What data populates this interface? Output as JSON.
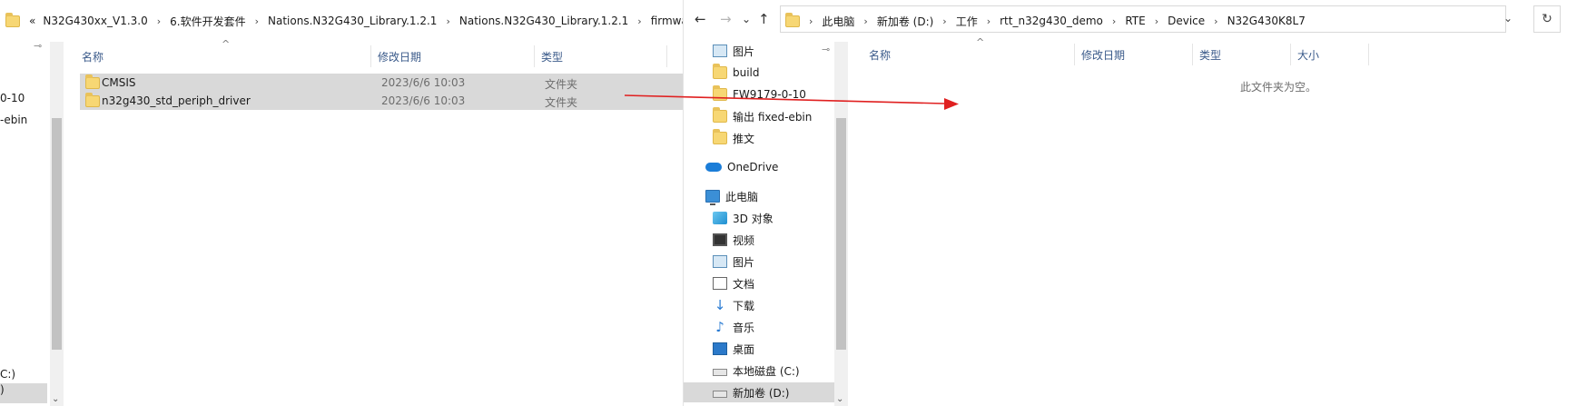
{
  "left_window": {
    "breadcrumbs": [
      "«",
      "N32G430xx_V1.3.0",
      "6.软件开发套件",
      "Nations.N32G430_Library.1.2.1",
      "Nations.N32G430_Library.1.2.1",
      "firmware"
    ],
    "columns": {
      "name": "名称",
      "date": "修改日期",
      "type": "类型"
    },
    "files": [
      {
        "name": "CMSIS",
        "date": "2023/6/6 10:03",
        "type": "文件夹"
      },
      {
        "name": "n32g430_std_periph_driver",
        "date": "2023/6/6 10:03",
        "type": "文件夹"
      }
    ],
    "nav_partial": [
      "0-10",
      "-ebin",
      "C:)",
      ")"
    ]
  },
  "right_window": {
    "nav_buttons": {
      "back": "←",
      "forward": "→",
      "down": "⌄",
      "up": "↑"
    },
    "breadcrumbs": [
      "此电脑",
      "新加卷 (D:)",
      "工作",
      "rtt_n32g430_demo",
      "RTE",
      "Device",
      "N32G430K8L7"
    ],
    "columns": {
      "name": "名称",
      "date": "修改日期",
      "type": "类型",
      "size": "大小"
    },
    "empty_message": "此文件夹为空。",
    "nav_items": [
      {
        "label": "图片",
        "icon": "pictures-icon"
      },
      {
        "label": "build",
        "icon": "folder-icon"
      },
      {
        "label": "FW9179-0-10",
        "icon": "folder-icon"
      },
      {
        "label": "输出 fixed-ebin",
        "icon": "folder-icon"
      },
      {
        "label": "推文",
        "icon": "folder-icon"
      },
      {
        "label": "OneDrive",
        "icon": "onedrive-icon"
      },
      {
        "label": "此电脑",
        "icon": "computer-icon"
      },
      {
        "label": "3D 对象",
        "icon": "3d-objects-icon"
      },
      {
        "label": "视频",
        "icon": "video-icon"
      },
      {
        "label": "图片",
        "icon": "pictures-icon"
      },
      {
        "label": "文档",
        "icon": "documents-icon"
      },
      {
        "label": "下载",
        "icon": "download-icon"
      },
      {
        "label": "音乐",
        "icon": "music-icon"
      },
      {
        "label": "桌面",
        "icon": "desktop-icon"
      },
      {
        "label": "本地磁盘 (C:)",
        "icon": "drive-icon"
      },
      {
        "label": "新加卷 (D:)",
        "icon": "drive-icon"
      }
    ]
  },
  "colors": {
    "selection": "#d9d9d9",
    "arrow": "#e02020",
    "header_text": "#3a5a8a"
  }
}
